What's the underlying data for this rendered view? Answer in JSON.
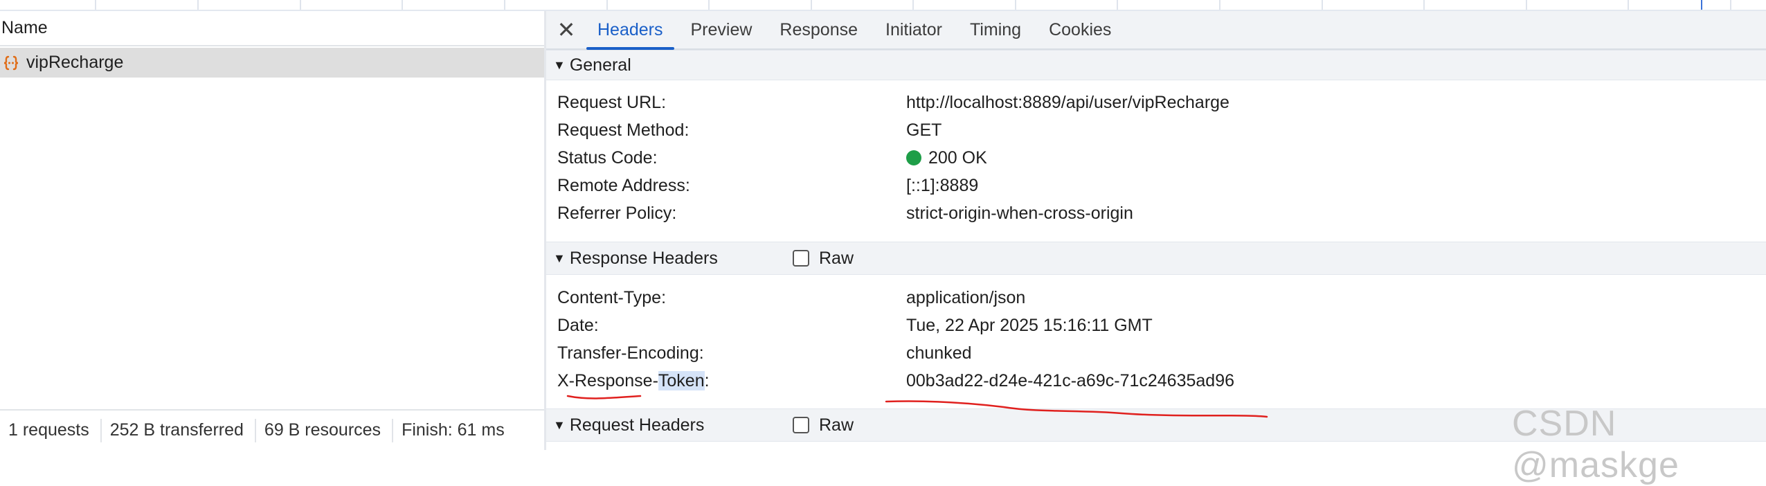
{
  "left_pane": {
    "column_header": "Name",
    "requests": [
      {
        "name": "vipRecharge",
        "icon": "fetch-braces-icon"
      }
    ],
    "status_bar": {
      "requests": "1 requests",
      "transferred": "252 B transferred",
      "resources": "69 B resources",
      "finish": "Finish: 61 ms"
    }
  },
  "tabs": {
    "close_symbol": "✕",
    "items": [
      "Headers",
      "Preview",
      "Response",
      "Initiator",
      "Timing",
      "Cookies"
    ],
    "active": "Headers"
  },
  "general": {
    "title": "General",
    "rows": [
      {
        "key": "Request URL:",
        "value": "http://localhost:8889/api/user/vipRecharge"
      },
      {
        "key": "Request Method:",
        "value": "GET"
      },
      {
        "key": "Status Code:",
        "value": "200 OK"
      },
      {
        "key": "Remote Address:",
        "value": "[::1]:8889"
      },
      {
        "key": "Referrer Policy:",
        "value": "strict-origin-when-cross-origin"
      }
    ]
  },
  "response_headers": {
    "title": "Response Headers",
    "raw_label": "Raw",
    "raw_checked": false,
    "rows": [
      {
        "key": "Content-Type:",
        "value": "application/json"
      },
      {
        "key": "Date:",
        "value": "Tue, 22 Apr 2025 15:16:11 GMT"
      },
      {
        "key": "Transfer-Encoding:",
        "value": "chunked"
      }
    ],
    "token_row": {
      "key_part1": "X-Response-",
      "key_part2": "Token",
      "key_part3": ":",
      "value": "00b3ad22-d24e-421c-a69c-71c24635ad96"
    }
  },
  "request_headers": {
    "title": "Request Headers",
    "raw_label": "Raw",
    "raw_checked": false
  },
  "colors": {
    "accent": "#1a5fc8",
    "status_ok": "#1e9e48",
    "annotation": "#e0201e",
    "selected_row": "#dedede"
  },
  "watermark": "CSDN @maskge"
}
